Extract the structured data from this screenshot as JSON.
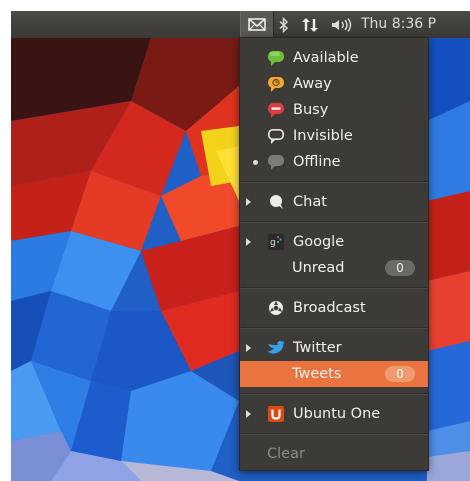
{
  "panel": {
    "clock": "Thu 8:36 P",
    "indicators": [
      {
        "icon": "envelope-icon"
      },
      {
        "icon": "bluetooth-icon"
      },
      {
        "icon": "network-arrows-icon"
      },
      {
        "icon": "speaker-icon"
      }
    ]
  },
  "menu": {
    "status": {
      "available": "Available",
      "away": "Away",
      "busy": "Busy",
      "invisible": "Invisible",
      "offline": "Offline",
      "selected": "Offline"
    },
    "chat": "Chat",
    "google": {
      "label": "Google",
      "unread_label": "Unread",
      "unread_count": "0"
    },
    "broadcast": "Broadcast",
    "twitter": {
      "label": "Twitter",
      "tweets_label": "Tweets",
      "tweets_count": "0"
    },
    "ubuntu_one": "Ubuntu One",
    "clear": "Clear"
  },
  "colors": {
    "available": "#6fbe3c",
    "away": "#f0a830",
    "busy": "#e03c3c",
    "highlight": "#e9743f",
    "twitter": "#3a9ee4",
    "ubuntu_one": "#dd4814"
  }
}
